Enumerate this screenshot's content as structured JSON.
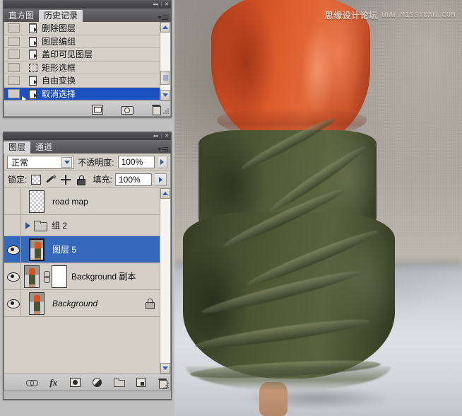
{
  "app": "Adobe Photoshop",
  "photo": {
    "watermark_cn": "思缘设计论坛",
    "watermark_url": "WWW.MISSYUAN.COM",
    "description": "Woman in orange tank top and olive ruffled skirt standing on light floor",
    "colors": {
      "top": "#dd5c2c",
      "skirt": "#4a5233",
      "wall": "#a39d96",
      "floor": "#d2d5d9"
    }
  },
  "history_panel": {
    "tabs": [
      {
        "label": "直方图",
        "active": false
      },
      {
        "label": "历史记录",
        "active": true
      }
    ],
    "menu_icon": "panel-menu-icon",
    "close_icon": "close-icon",
    "collapse_icon": "collapse-icon",
    "states": [
      {
        "label": "删除图层",
        "icon": "document-state-icon",
        "selected": false
      },
      {
        "label": "图层编组",
        "icon": "document-state-icon",
        "selected": false
      },
      {
        "label": "盖印可见图层",
        "icon": "document-state-icon",
        "selected": false
      },
      {
        "label": "矩形选框",
        "icon": "marquee-state-icon",
        "selected": false
      },
      {
        "label": "自由变换",
        "icon": "document-state-icon",
        "selected": false
      },
      {
        "label": "取消选择",
        "icon": "document-state-icon",
        "selected": true
      }
    ],
    "footer_buttons": [
      {
        "name": "new-document-from-state-button",
        "icon": "new-document-icon"
      },
      {
        "name": "new-snapshot-button",
        "icon": "camera-icon"
      },
      {
        "name": "delete-state-button",
        "icon": "trash-icon"
      }
    ],
    "scrollbar": {
      "up_icon": "chevron-up-icon",
      "down_icon": "chevron-down-icon"
    }
  },
  "layers_panel": {
    "tabs": [
      {
        "label": "图层",
        "active": true
      },
      {
        "label": "通道",
        "active": false
      }
    ],
    "blend_mode": "正常",
    "opacity_label": "不透明度:",
    "opacity_value": "100%",
    "lock_label": "锁定:",
    "lock_buttons": [
      {
        "name": "lock-transparent-pixels-button",
        "icon": "checkerboard-icon"
      },
      {
        "name": "lock-image-pixels-button",
        "icon": "brush-icon"
      },
      {
        "name": "lock-position-button",
        "icon": "move-cross-icon"
      },
      {
        "name": "lock-all-button",
        "icon": "padlock-icon"
      }
    ],
    "fill_label": "填充:",
    "fill_value": "100%",
    "layers": [
      {
        "name": "road map",
        "visible": false,
        "selected": false,
        "thumb": "checker",
        "italic": false,
        "kind": "layer"
      },
      {
        "name": "组 2",
        "visible": false,
        "selected": false,
        "thumb": "folder",
        "italic": false,
        "kind": "group",
        "expanded": false
      },
      {
        "name": "图层 5",
        "visible": true,
        "selected": true,
        "thumb": "photo",
        "italic": false,
        "kind": "layer"
      },
      {
        "name": "Background 副本",
        "visible": true,
        "selected": false,
        "thumb": "photo",
        "italic": false,
        "kind": "layer",
        "has_mask": true,
        "linked": true
      },
      {
        "name": "Background",
        "visible": true,
        "selected": false,
        "thumb": "photo",
        "italic": true,
        "kind": "layer",
        "locked": true
      }
    ],
    "footer_buttons": [
      {
        "name": "link-layers-button",
        "icon": "link-icon"
      },
      {
        "name": "layer-style-button",
        "icon": "fx-icon"
      },
      {
        "name": "add-layer-mask-button",
        "icon": "mask-icon"
      },
      {
        "name": "new-adjustment-layer-button",
        "icon": "half-circle-icon"
      },
      {
        "name": "new-group-button",
        "icon": "folder-icon"
      },
      {
        "name": "new-layer-button",
        "icon": "new-layer-icon"
      },
      {
        "name": "delete-layer-button",
        "icon": "trash-icon"
      }
    ],
    "scrollbar": {
      "up_icon": "chevron-up-icon",
      "down_icon": "chevron-down-icon"
    }
  }
}
